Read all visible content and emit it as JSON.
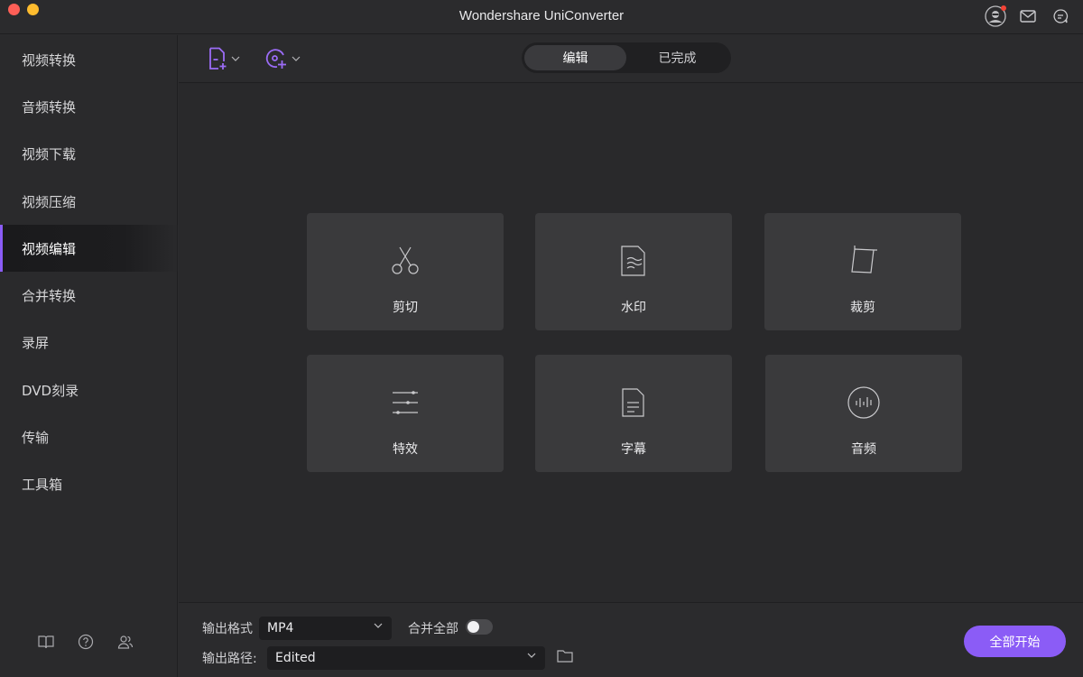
{
  "window": {
    "title": "Wondershare UniConverter"
  },
  "sidebar": {
    "items": [
      {
        "label": "视频转换"
      },
      {
        "label": "音频转换"
      },
      {
        "label": "视频下载"
      },
      {
        "label": "视频压缩"
      },
      {
        "label": "视频编辑",
        "active": true
      },
      {
        "label": "合并转换"
      },
      {
        "label": "录屏"
      },
      {
        "label": "DVD刻录"
      },
      {
        "label": "传输"
      },
      {
        "label": "工具箱"
      }
    ],
    "bottom_icons": [
      "book-icon",
      "help-icon",
      "users-icon"
    ]
  },
  "toolbar": {
    "add_file_icon": "add-file-icon",
    "add_dvd_icon": "add-dvd-icon",
    "tabs": [
      {
        "label": "编辑",
        "active": true
      },
      {
        "label": "已完成",
        "active": false
      }
    ]
  },
  "tools": [
    {
      "label": "剪切",
      "icon": "scissors-icon"
    },
    {
      "label": "水印",
      "icon": "watermark-icon"
    },
    {
      "label": "裁剪",
      "icon": "crop-icon"
    },
    {
      "label": "特效",
      "icon": "sliders-icon"
    },
    {
      "label": "字幕",
      "icon": "subtitle-icon"
    },
    {
      "label": "音频",
      "icon": "audio-icon"
    }
  ],
  "bottom": {
    "output_format_label": "输出格式",
    "output_format_value": "MP4",
    "merge_all_label": "合并全部",
    "merge_all_on": false,
    "output_path_label": "输出路径:",
    "output_path_value": "Edited",
    "start_all_label": "全部开始"
  },
  "colors": {
    "accent": "#8b5cf6",
    "background": "#2b2b2d",
    "card": "#3a3a3c",
    "close": "#fe5f57",
    "minimize": "#febc2e",
    "notification": "#f44336"
  }
}
